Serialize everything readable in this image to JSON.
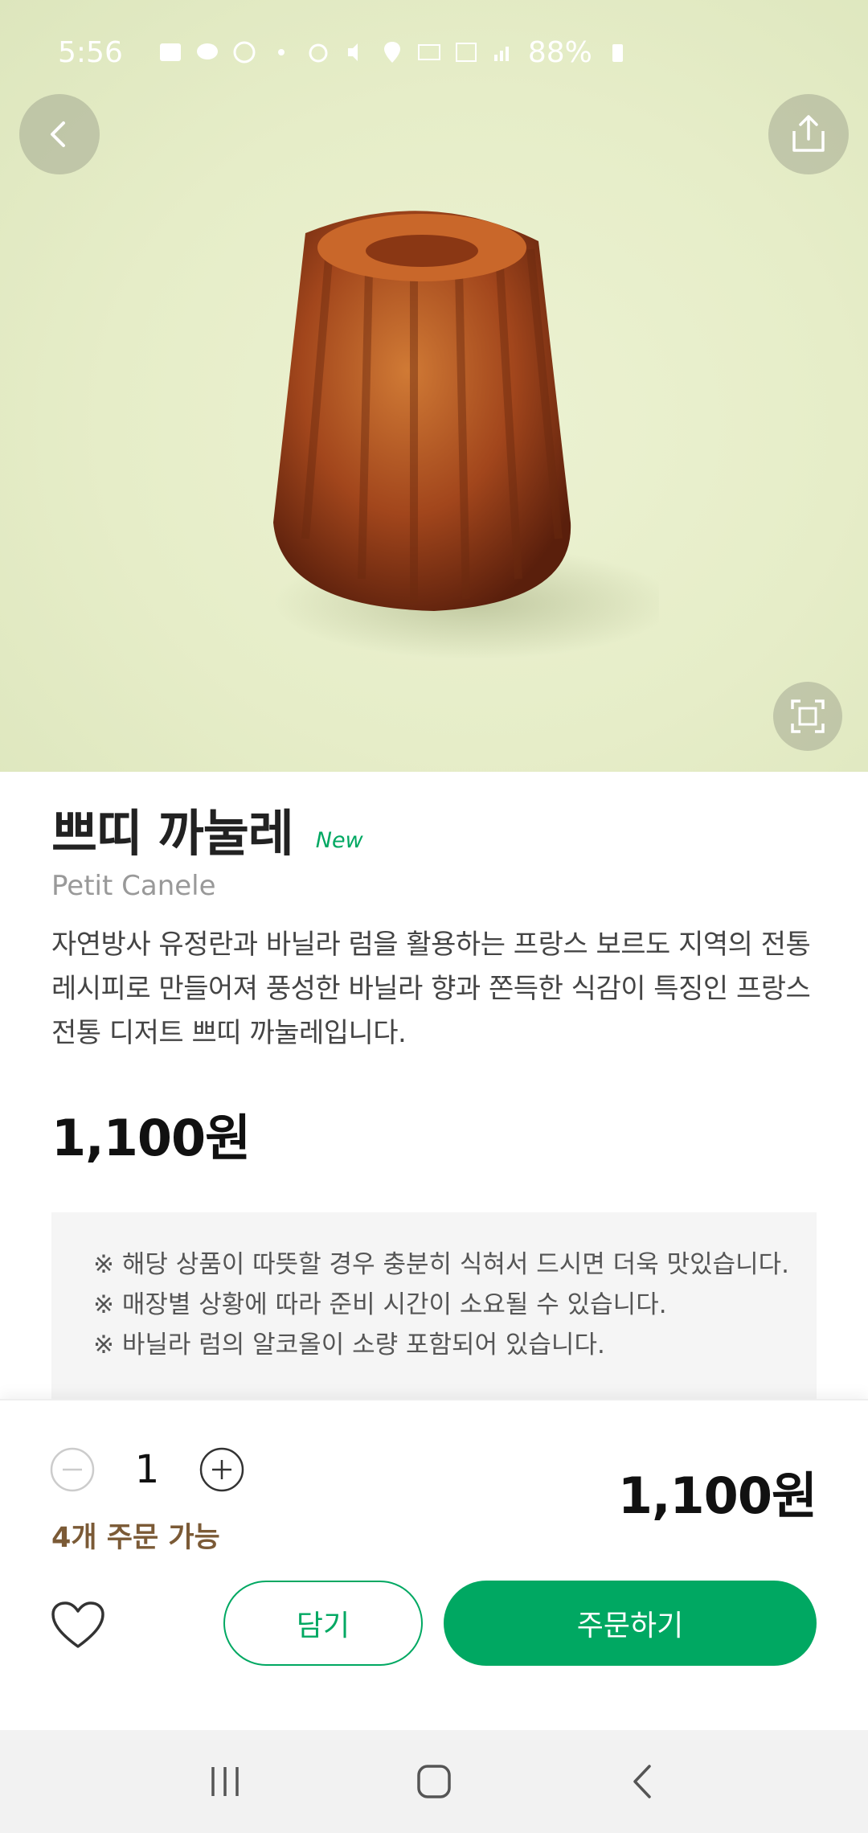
{
  "status_bar": {
    "time": "5:56",
    "battery": "88%"
  },
  "product": {
    "name_kr": "쁘띠 까눌레",
    "badge": "New",
    "name_en": "Petit Canele",
    "description": "자연방사 유정란과 바닐라 럼을 활용하는 프랑스 보르도 지역의 전통 레시피로 만들어져 풍성한 바닐라 향과 쫀득한 식감이 특징인 프랑스 전통 디저트 쁘띠 까눌레입니다.",
    "price": "1,100원"
  },
  "notice": {
    "lines": [
      "※ 해당 상품이 따뜻할 경우 충분히 식혀서 드시면 더욱 맛있습니다.",
      "※ 매장별 상황에 따라 준비 시간이 소요될 수 있습니다.",
      "※ 바닐라 럼의 알코올이 소량 포함되어 있습니다."
    ]
  },
  "order_panel": {
    "quantity": "1",
    "available": "4개 주문 가능",
    "total": "1,100원",
    "cart_label": "담기",
    "order_label": "주문하기"
  },
  "icons": {
    "back": "chevron-left-icon",
    "share": "share-icon",
    "zoom": "fullscreen-icon",
    "minus": "minus-circle-icon",
    "plus": "plus-circle-icon",
    "favorite": "heart-outline-icon",
    "nav_recent": "recent-apps-icon",
    "nav_home": "home-icon",
    "nav_back": "back-icon"
  },
  "colors": {
    "accent": "#00a862",
    "available_text": "#7b5a36",
    "hero_bg": "#e6edc8"
  }
}
